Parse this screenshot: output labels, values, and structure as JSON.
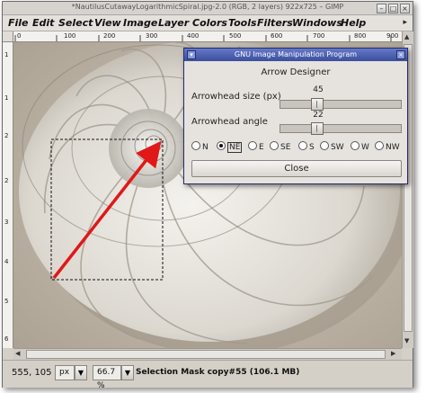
{
  "window": {
    "title": "*NautilusCutawayLogarithmicSpiral.jpg-2.0 (RGB, 2 layers) 922x725 – GIMP",
    "buttons": [
      "–",
      "□",
      "×"
    ]
  },
  "menubar": {
    "items": [
      "File",
      "Edit",
      "Select",
      "View",
      "Image",
      "Layer",
      "Colors",
      "Tools",
      "Filters",
      "Windows",
      "Help"
    ],
    "more_icon": "▸"
  },
  "rulers": {
    "h_ticks": [
      "0",
      "100",
      "200",
      "300",
      "400",
      "500",
      "600",
      "700",
      "800",
      "900"
    ],
    "v_ticks": [
      "1",
      "1",
      "2",
      "2",
      "3",
      "4",
      "5",
      "6"
    ]
  },
  "dialog": {
    "title": "GNU Image Manipulation Program",
    "heading": "Arrow Designer",
    "size_label": "Arrowhead size (px)",
    "size_value": "45",
    "size_fraction": 0.28,
    "angle_label": "Arrowhead angle",
    "angle_value": "22",
    "angle_fraction": 0.28,
    "directions": [
      "N",
      "NE",
      "E",
      "SE",
      "S",
      "SW",
      "W",
      "NW"
    ],
    "selected_direction": "NE",
    "close_label": "Close"
  },
  "statusbar": {
    "coords": "555, 105",
    "unit": "px",
    "zoom": "66.7 %",
    "message": "Selection Mask copy#55 (106.1 MB)"
  },
  "colors": {
    "arrow": "#e01818",
    "dialog_titlebar": "#4a5db0"
  }
}
